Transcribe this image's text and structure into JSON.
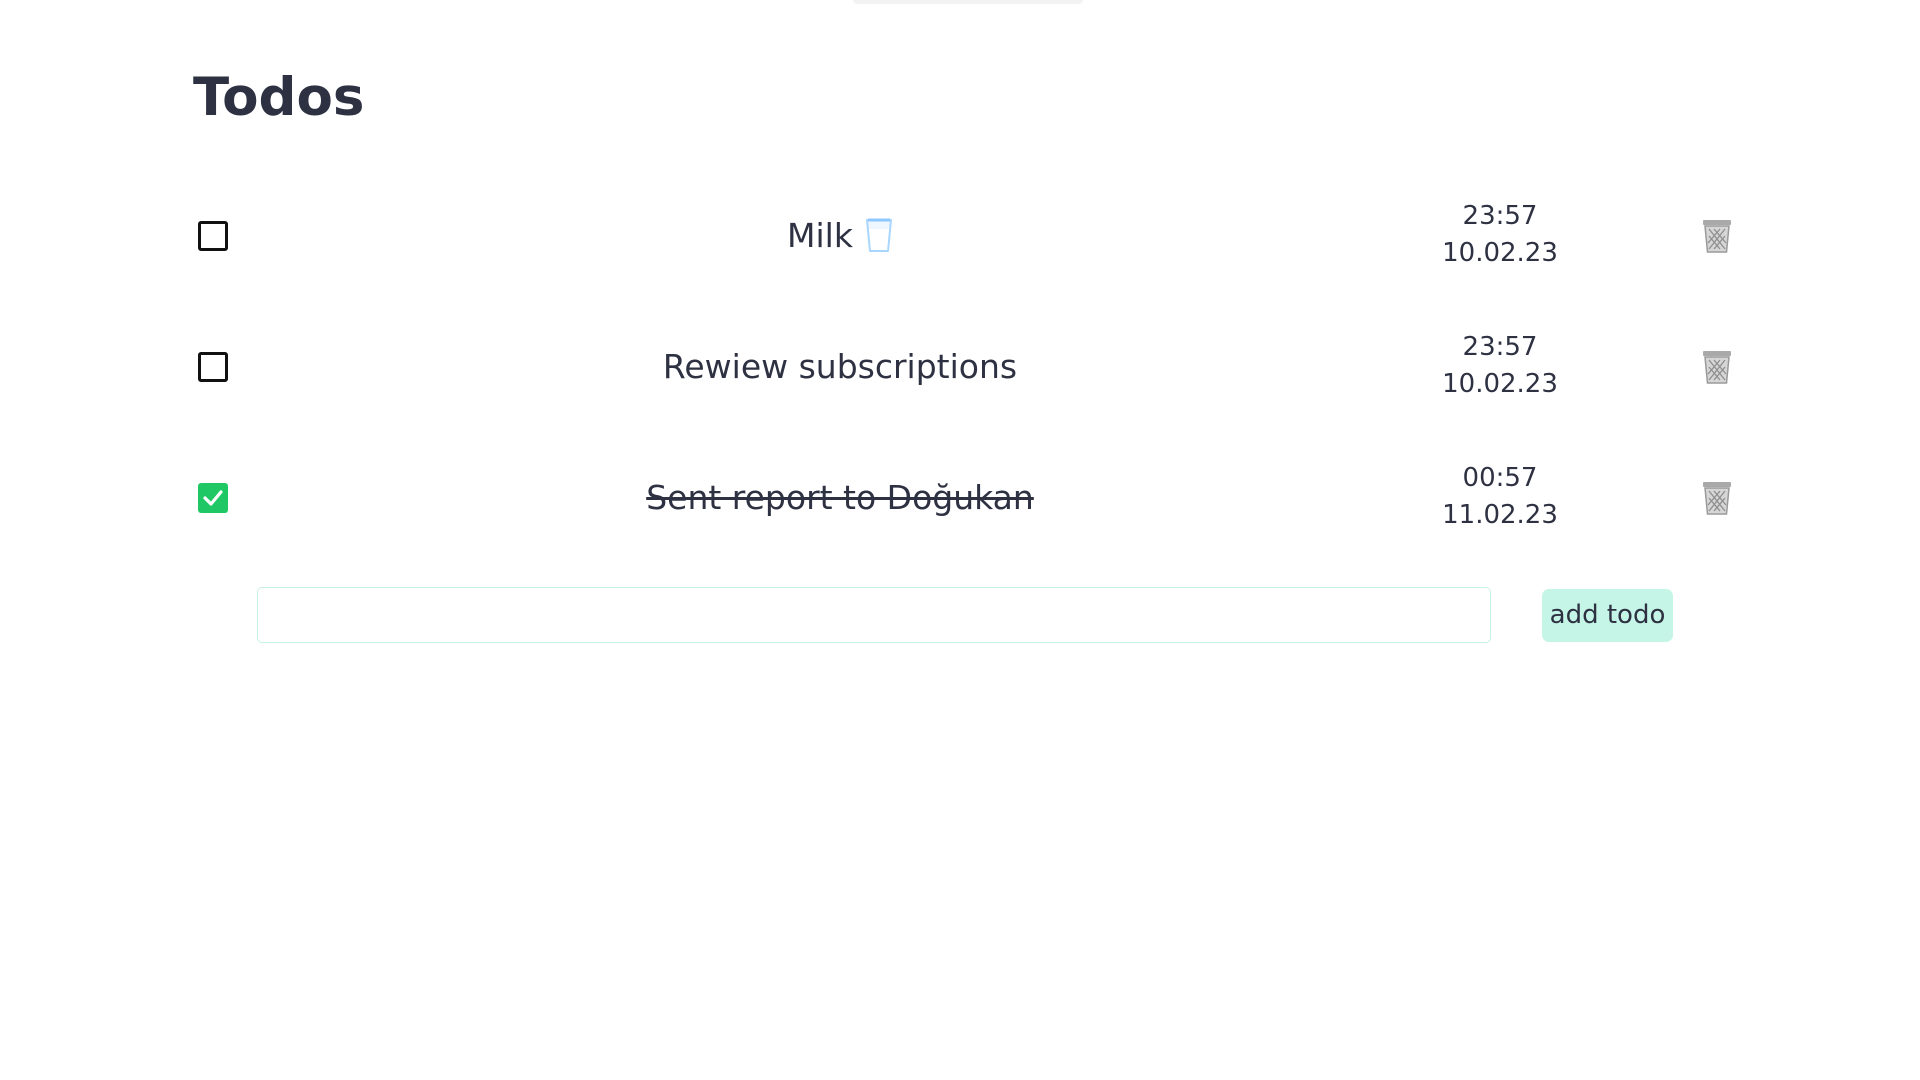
{
  "page": {
    "title": "Todos"
  },
  "todos": [
    {
      "text": "Milk",
      "icon": "milk-glass-icon",
      "completed": false,
      "time": "23:57",
      "date": "10.02.23"
    },
    {
      "text": "Rewiew subscriptions",
      "completed": false,
      "time": "23:57",
      "date": "10.02.23"
    },
    {
      "text": "Sent report to Doğukan",
      "completed": true,
      "time": "00:57",
      "date": "11.02.23"
    }
  ],
  "new_todo": {
    "value": "",
    "placeholder": "",
    "button_label": "add todo"
  },
  "icons": {
    "checkbox_checked": "checkmark-icon",
    "delete": "trash-can-icon"
  },
  "colors": {
    "text": "#2d3142",
    "checked_green": "#1fc865",
    "button_bg": "#c5f5e6",
    "input_border": "#c8f0e3",
    "trash_gray": "#a9a9a9"
  }
}
